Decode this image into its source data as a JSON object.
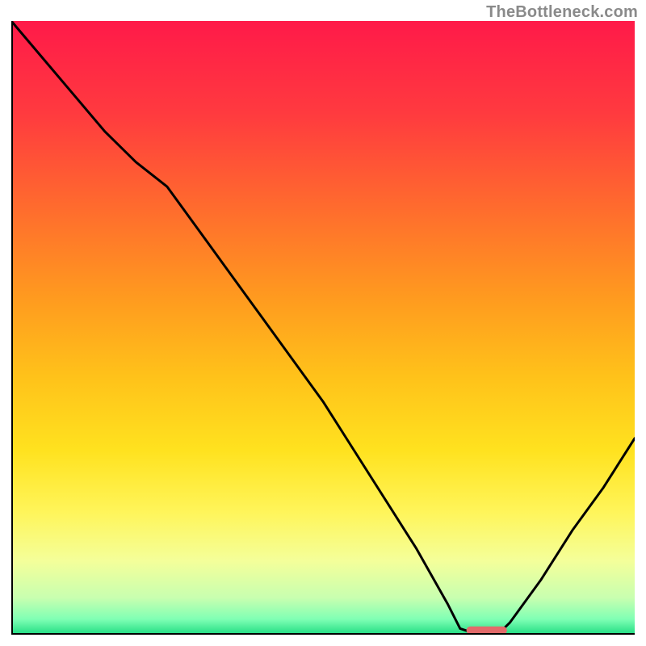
{
  "watermark": "TheBottleneck.com",
  "colors": {
    "gradient_stops": [
      {
        "offset": 0.0,
        "color": "#ff1a49"
      },
      {
        "offset": 0.15,
        "color": "#ff3a3f"
      },
      {
        "offset": 0.3,
        "color": "#ff6a2e"
      },
      {
        "offset": 0.45,
        "color": "#ff9a1f"
      },
      {
        "offset": 0.58,
        "color": "#ffc21a"
      },
      {
        "offset": 0.7,
        "color": "#ffe21f"
      },
      {
        "offset": 0.8,
        "color": "#fff55a"
      },
      {
        "offset": 0.88,
        "color": "#f4ff9a"
      },
      {
        "offset": 0.94,
        "color": "#c8ffb0"
      },
      {
        "offset": 0.975,
        "color": "#7fffb4"
      },
      {
        "offset": 1.0,
        "color": "#1fdc82"
      }
    ],
    "curve": "#000000",
    "pill": "#e26a6a",
    "axis": "#000000"
  },
  "chart_data": {
    "type": "line",
    "title": "",
    "xlabel": "",
    "ylabel": "",
    "xlim": [
      0,
      100
    ],
    "ylim": [
      0,
      100
    ],
    "x": [
      0,
      5,
      10,
      15,
      20,
      25,
      30,
      35,
      40,
      45,
      50,
      55,
      60,
      65,
      70,
      72,
      75,
      78,
      80,
      85,
      90,
      95,
      100
    ],
    "series": [
      {
        "name": "bottleneck-curve",
        "values": [
          100,
          94,
          88,
          82,
          77,
          73,
          66,
          59,
          52,
          45,
          38,
          30,
          22,
          14,
          5,
          1,
          0,
          0,
          2,
          9,
          17,
          24,
          32
        ]
      }
    ],
    "marker": {
      "x_start": 73,
      "x_end": 79.5,
      "y": 0.7
    }
  }
}
